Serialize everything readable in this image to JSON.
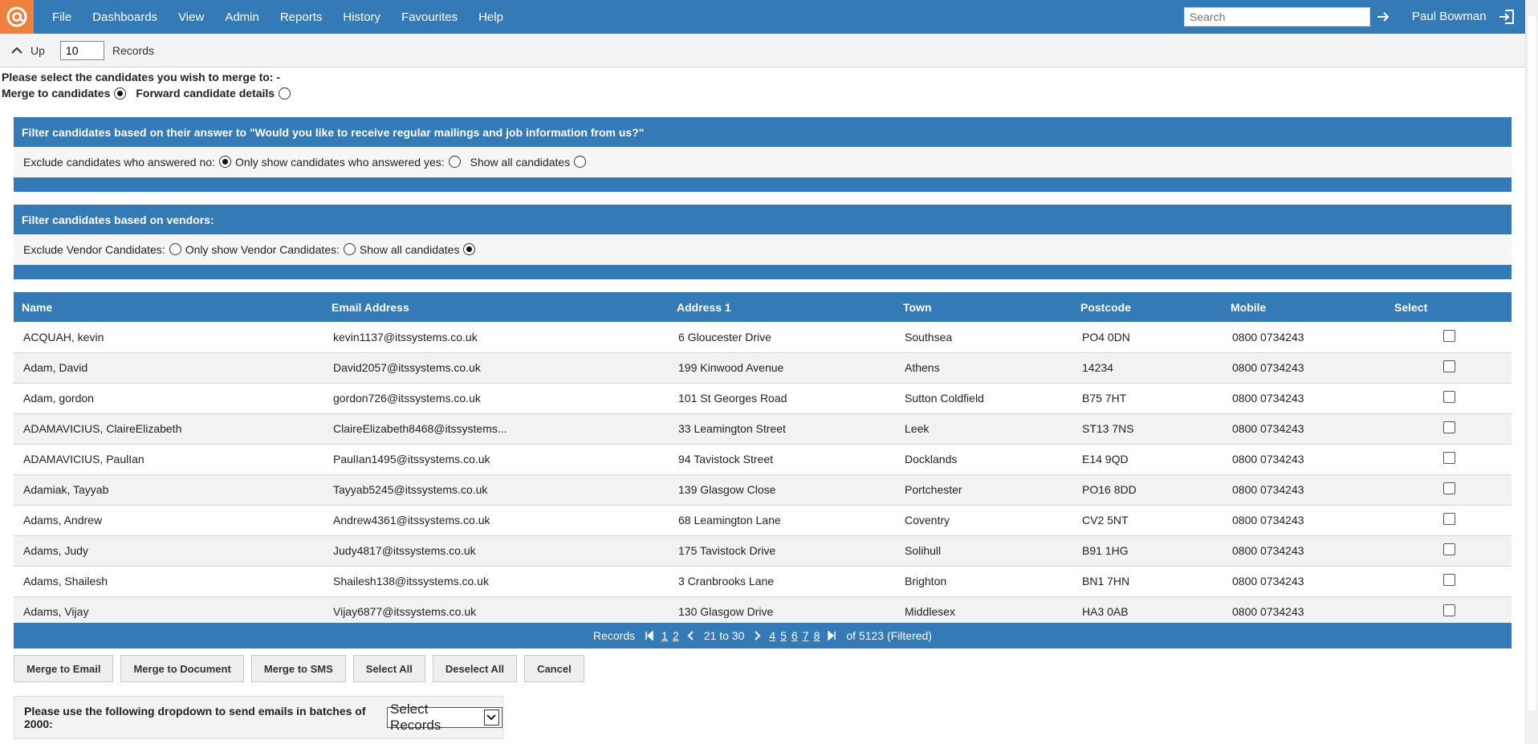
{
  "nav": {
    "menu": [
      "File",
      "Dashboards",
      "View",
      "Admin",
      "Reports",
      "History",
      "Favourites",
      "Help"
    ],
    "search_placeholder": "Search",
    "user_name": "Paul Bowman"
  },
  "upbar": {
    "up_label": "Up",
    "records_value": "10",
    "records_label": "Records"
  },
  "merge": {
    "prompt": "Please select the candidates you wish to merge to: -",
    "merge_label": "Merge to candidates",
    "forward_label": "Forward candidate details",
    "selected": "merge"
  },
  "filter_mailing": {
    "title": "Filter candidates based on their answer to \"Would you like to receive regular mailings and job information from us?\"",
    "options": [
      "Exclude candidates who answered no:",
      "Only show candidates who answered yes:",
      "Show all candidates"
    ],
    "selected": 0
  },
  "filter_vendor": {
    "title": "Filter candidates based on vendors:",
    "options": [
      "Exclude Vendor Candidates:",
      "Only show Vendor Candidates:",
      "Show all candidates"
    ],
    "selected": 2
  },
  "table": {
    "headers": [
      "Name",
      "Email Address",
      "Address 1",
      "Town",
      "Postcode",
      "Mobile",
      "Select"
    ],
    "rows": [
      [
        "ACQUAH, kevin",
        "kevin1137@itssystems.co.uk",
        "6 Gloucester Drive",
        "Southsea",
        "PO4 0DN",
        "0800 0734243"
      ],
      [
        "Adam, David",
        "David2057@itssystems.co.uk",
        "199 Kinwood Avenue",
        "Athens",
        "14234",
        "0800 0734243"
      ],
      [
        "Adam, gordon",
        "gordon726@itssystems.co.uk",
        "101 St Georges Road",
        "Sutton Coldfield",
        "B75 7HT",
        "0800 0734243"
      ],
      [
        "ADAMAVICIUS, ClaireElizabeth",
        "ClaireElizabeth8468@itssystems...",
        "33 Leamington Street",
        "Leek",
        "ST13 7NS",
        "0800 0734243"
      ],
      [
        "ADAMAVICIUS, PaulIan",
        "PaulIan1495@itssystems.co.uk",
        "94 Tavistock Street",
        "Docklands",
        "E14 9QD",
        "0800 0734243"
      ],
      [
        "Adamiak, Tayyab",
        "Tayyab5245@itssystems.co.uk",
        "139 Glasgow Close",
        "Portchester",
        "PO16 8DD",
        "0800 0734243"
      ],
      [
        "Adams, Andrew",
        "Andrew4361@itssystems.co.uk",
        "68 Leamington Lane",
        "Coventry",
        "CV2 5NT",
        "0800 0734243"
      ],
      [
        "Adams, Judy",
        "Judy4817@itssystems.co.uk",
        "175 Tavistock Drive",
        "Solihull",
        "B91 1HG",
        "0800 0734243"
      ],
      [
        "Adams, Shailesh",
        "Shailesh138@itssystems.co.uk",
        "3 Cranbrooks Lane",
        "Brighton",
        "BN1 7HN",
        "0800 0734243"
      ],
      [
        "Adams, Vijay",
        "Vijay6877@itssystems.co.uk",
        "130 Glasgow Drive",
        "Middlesex",
        "HA3 0AB",
        "0800 0734243"
      ]
    ]
  },
  "pager": {
    "label": "Records",
    "pages_before": [
      "1",
      "2"
    ],
    "current": "21 to 30",
    "pages_after": [
      "4",
      "5",
      "6",
      "7",
      "8"
    ],
    "total": "of 5123 (Filtered)"
  },
  "buttons": [
    "Merge to Email",
    "Merge to Document",
    "Merge to SMS",
    "Select All",
    "Deselect All",
    "Cancel"
  ],
  "batch": {
    "label": "Please use the following dropdown to send emails in batches of 2000:",
    "select_value": "Select Records"
  },
  "colors": {
    "header_blue": "#337ab7",
    "logo_orange": "#f0813c"
  }
}
